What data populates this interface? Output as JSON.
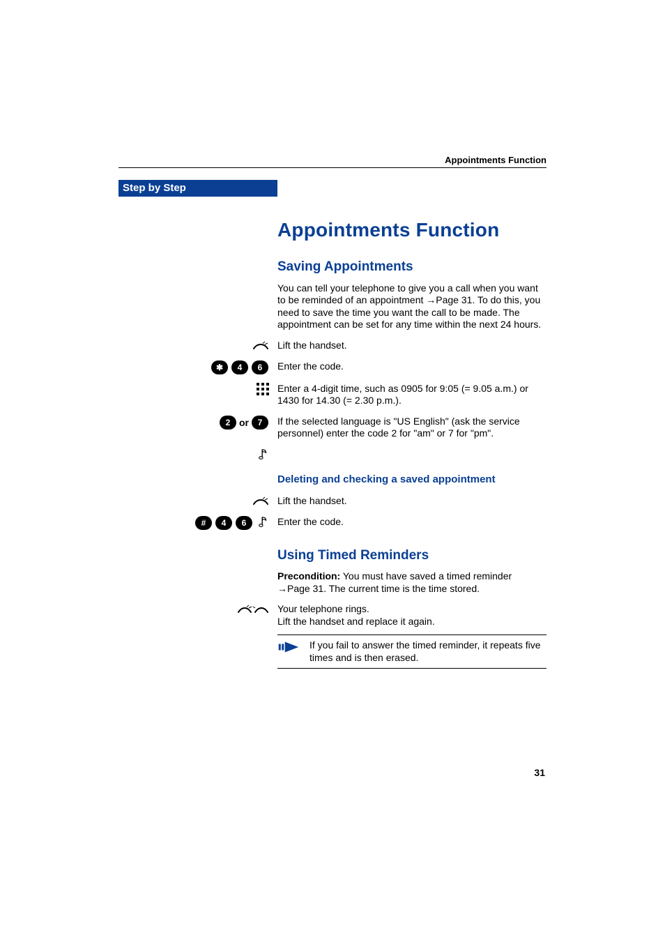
{
  "runningHeader": "Appointments Function",
  "sidebar": {
    "title": "Step by Step"
  },
  "h1": "Appointments Function",
  "saving": {
    "heading": "Saving Appointments",
    "intro1": "You can tell your telephone to give you a call when you want to be reminded of an appointment ",
    "introRef": "Page 31",
    "intro2": ". To do this, you need to save the time you want the call to be made. The appointment can be set for any time within the next 24 hours.",
    "step_lift": "Lift the handset.",
    "code_keys": [
      "✱",
      "4",
      "6"
    ],
    "step_code": "Enter the code.",
    "step_time": "Enter a 4-digit time, such as 0905 for 9:05 (= 9.05 a.m.) or 1430 for 14.30 (= 2.30 p.m.).",
    "ampm_or": " or ",
    "ampm_keys": [
      "2",
      "7"
    ],
    "step_ampm": "If the selected language is \"US English\" (ask the service personnel) enter the code 2 for \"am\" or 7 for \"pm\".",
    "delete_heading": "Deleting and checking a saved appointment",
    "delete_lift": "Lift the handset.",
    "delete_code_keys": [
      "#",
      "4",
      "6"
    ],
    "delete_code": "Enter the code."
  },
  "reminders": {
    "heading": "Using Timed Reminders",
    "precond_label": "Precondition:",
    "precond_text1": " You must have saved a timed reminder ",
    "precond_ref": "Page 31",
    "precond_text2": ". The current time is the time stored.",
    "ring1": "Your telephone rings.",
    "ring2": "Lift the handset and replace it again.",
    "note": "If you fail to answer the timed reminder, it repeats five times and is then erased."
  },
  "pageNumber": "31"
}
